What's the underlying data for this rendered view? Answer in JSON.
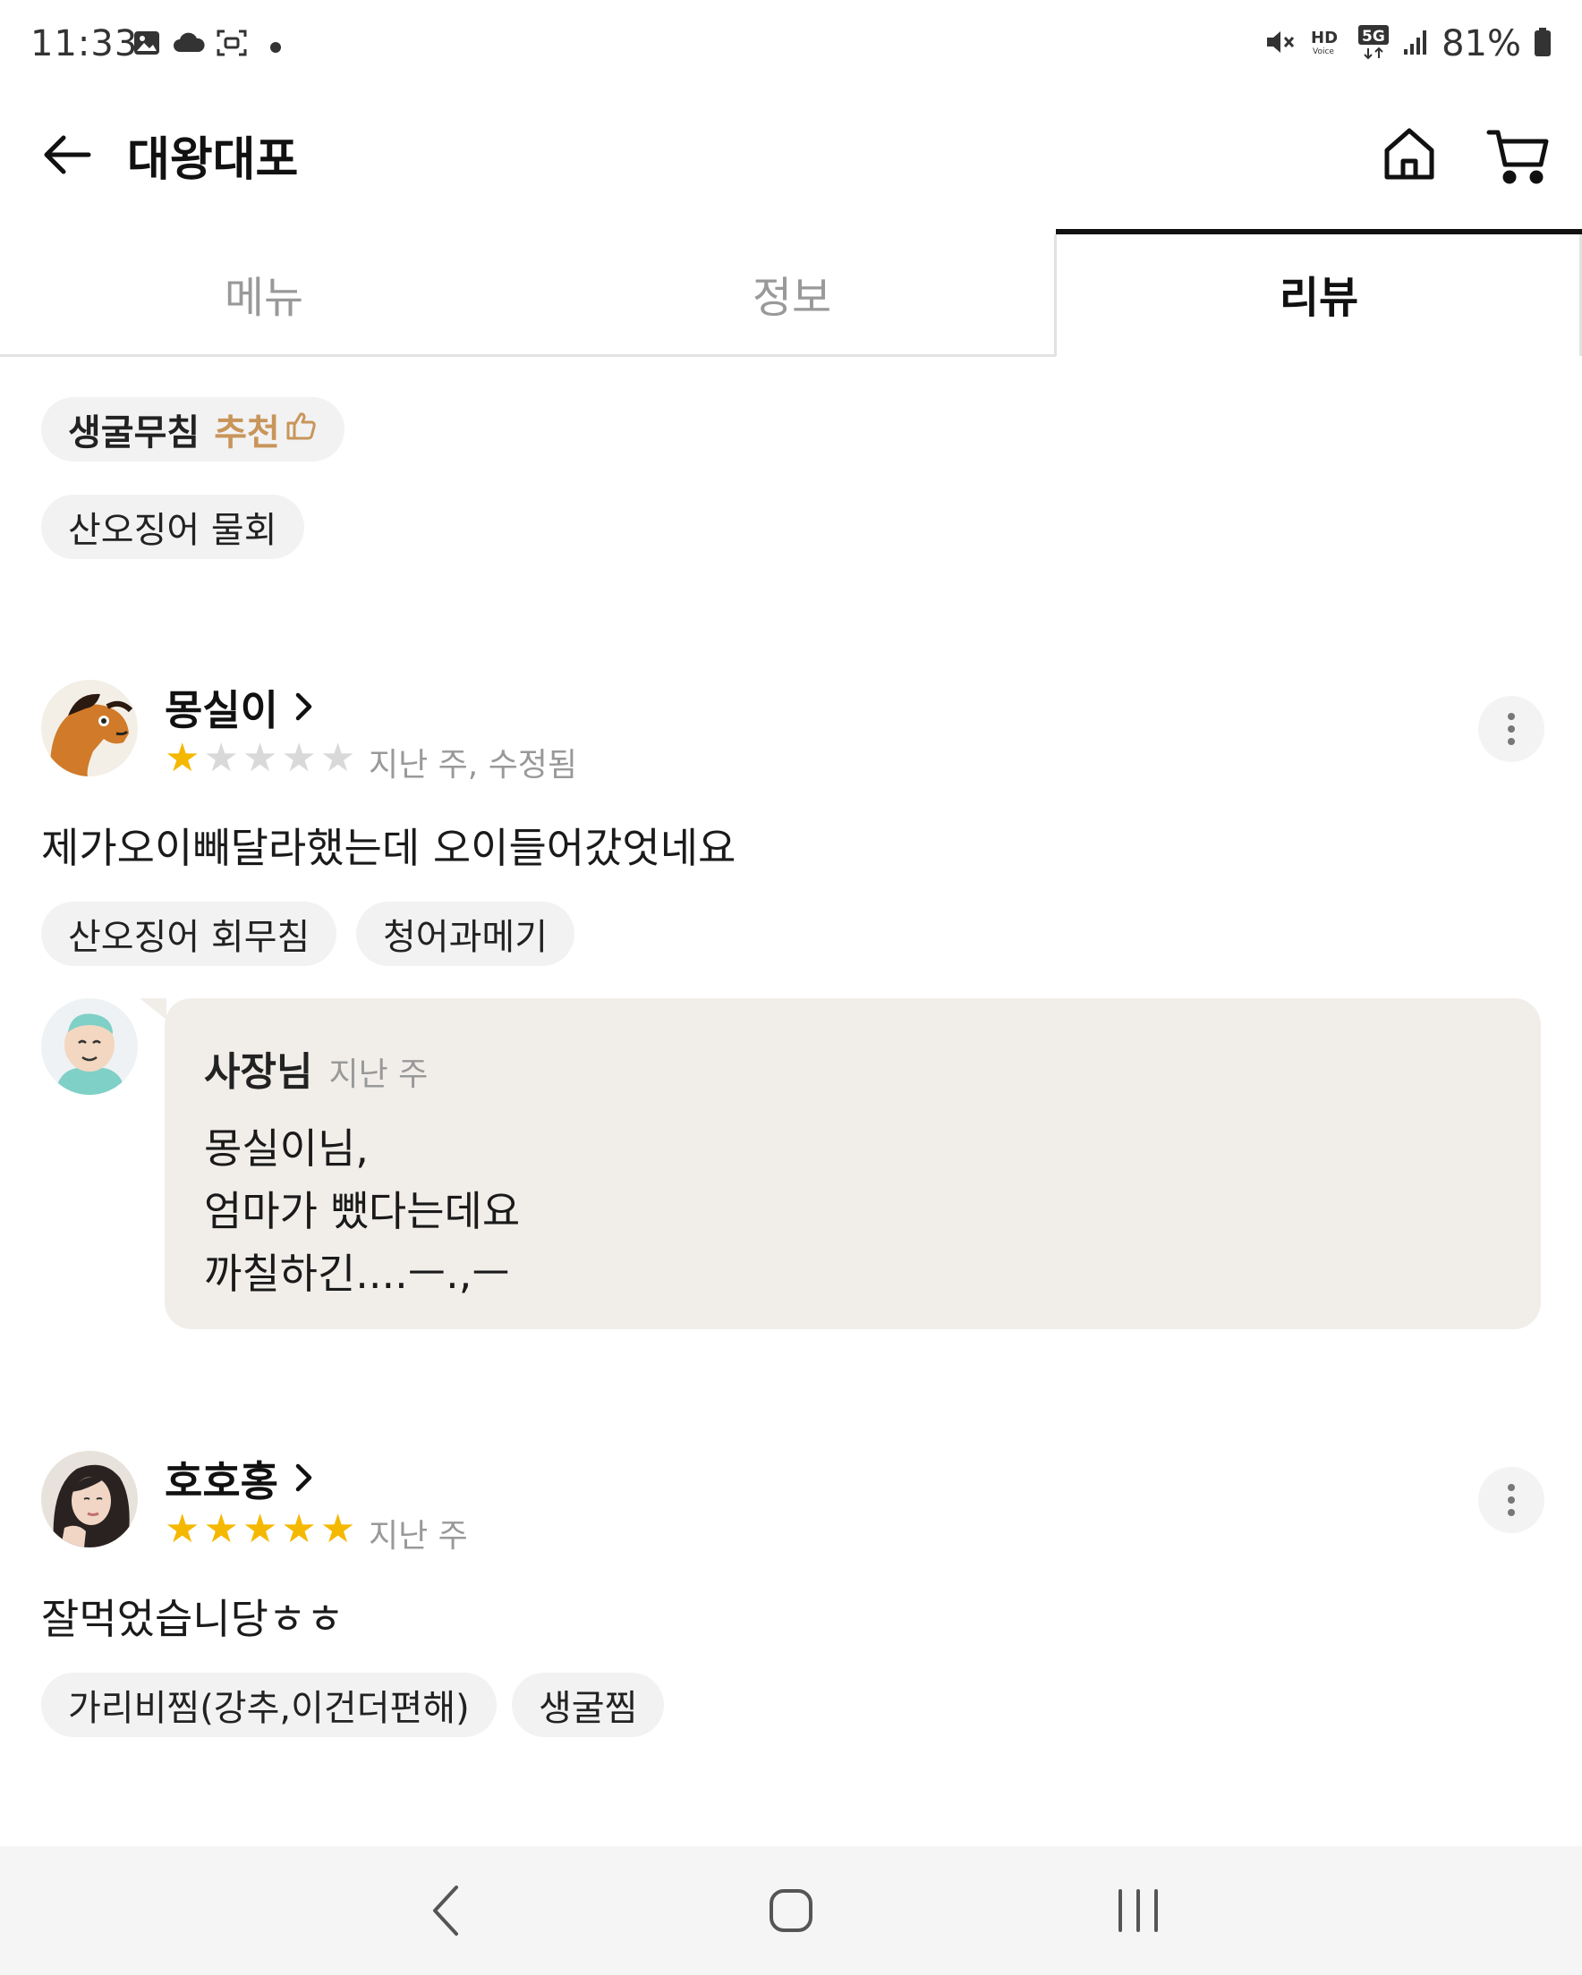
{
  "status_bar": {
    "time": "11:33",
    "battery": "81%",
    "icons": [
      "gallery-icon",
      "cloud-icon",
      "screenshot-icon",
      "dot-icon",
      "mute-icon",
      "hd-voice-icon",
      "5g-icon",
      "signal-icon",
      "battery-icon"
    ]
  },
  "app_bar": {
    "title": "대왕대포",
    "icons": [
      "back-arrow-icon",
      "home-icon",
      "cart-icon"
    ]
  },
  "tabs": [
    {
      "label": "메뉴",
      "active": false
    },
    {
      "label": "정보",
      "active": false
    },
    {
      "label": "리뷰",
      "active": true
    }
  ],
  "top_chips": [
    {
      "label": "생굴무침",
      "recommend": "추천"
    },
    {
      "label": "산오징어 물회"
    }
  ],
  "reviews": [
    {
      "name": "몽실이",
      "rating": 1,
      "max_rating": 5,
      "meta": "지난 주, 수정됨",
      "text": "제가오이빼달라했는데 오이들어갔엇네요",
      "chips": [
        "산오징어 회무침",
        "청어과메기"
      ],
      "reply": {
        "author": "사장님",
        "time": "지난 주",
        "lines": [
          "몽실이님,",
          "엄마가 뺐다는데요",
          "까칠하긴....ㅡ.,ㅡ"
        ]
      }
    },
    {
      "name": "호호홍",
      "rating": 5,
      "max_rating": 5,
      "meta": "지난 주",
      "text": "잘먹었습니당ㅎㅎ",
      "chips": [
        "가리비찜(강추,이건더편해)",
        "생굴찜"
      ]
    }
  ],
  "colors": {
    "star_on": "#f5b800",
    "star_off": "#d9d9d9",
    "recommend": "#c8955a",
    "bubble": "#f1eeea",
    "chip": "#f2f2f2"
  }
}
